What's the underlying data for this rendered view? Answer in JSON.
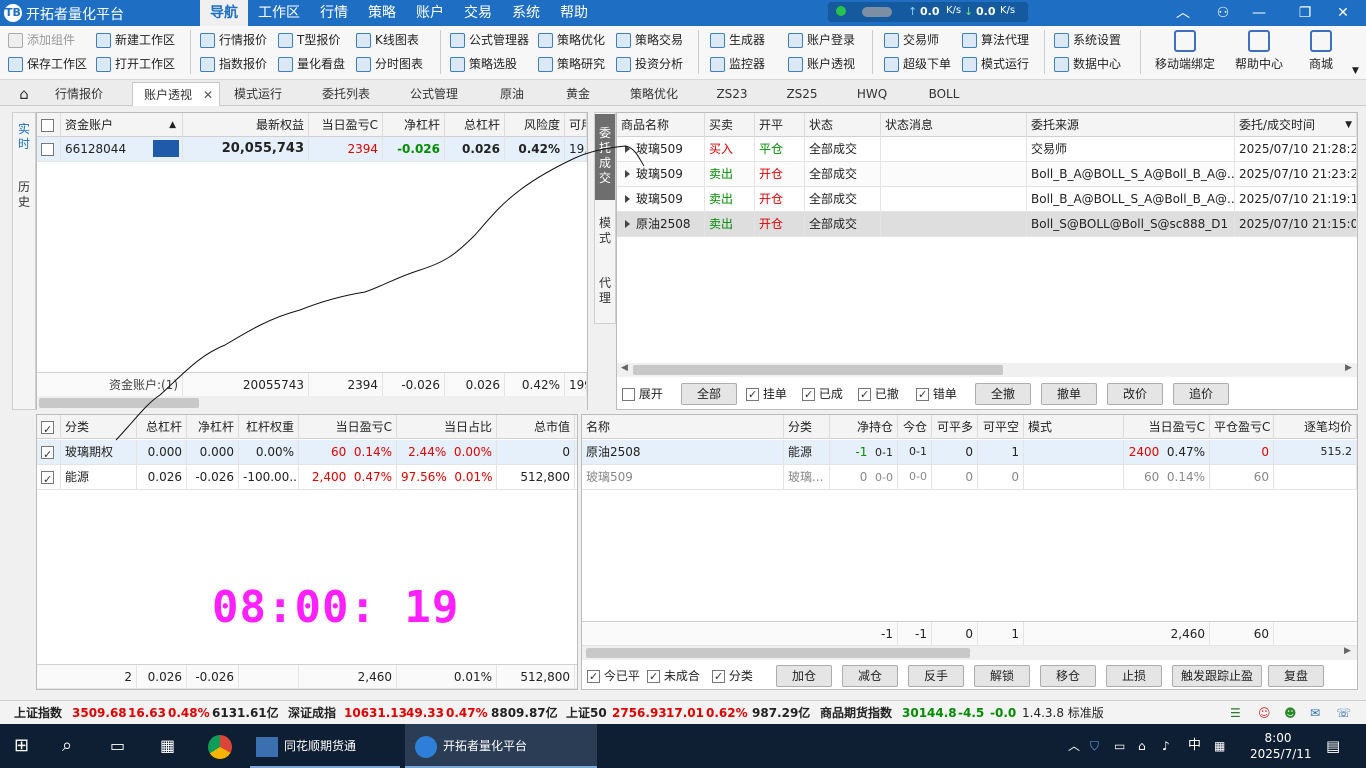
{
  "title_bar": {
    "app_title": "开拓者量化平台",
    "logo_text": "TB",
    "menu": [
      "导航",
      "工作区",
      "行情",
      "策略",
      "账户",
      "交易",
      "系统",
      "帮助"
    ],
    "net_up": "0.0",
    "net_down": "0.0",
    "net_unit": "K/s"
  },
  "toolbar": {
    "g1": [
      "添加组件",
      "新建工作区",
      "保存工作区",
      "打开工作区"
    ],
    "g2": [
      "行情报价",
      "T型报价",
      "K线图表",
      "指数报价",
      "量化看盘",
      "分时图表"
    ],
    "g3": [
      "公式管理器",
      "策略优化",
      "策略交易",
      "策略选股",
      "策略研究",
      "投资分析"
    ],
    "g4": [
      "生成器",
      "账户登录",
      "监控器",
      "账户透视"
    ],
    "g5": [
      "交易师",
      "算法代理",
      "超级下单",
      "模式运行"
    ],
    "g6": [
      "系统设置",
      "数据中心"
    ],
    "big": [
      "移动端绑定",
      "帮助中心",
      "商城"
    ]
  },
  "tabs": [
    "行情报价",
    "账户透视",
    "模式运行",
    "委托列表",
    "公式管理",
    "原油",
    "黄金",
    "策略优化",
    "ZS23",
    "ZS25",
    "HWQ",
    "BOLL"
  ],
  "left_vtabs": {
    "realtime": "实时",
    "history": "历史"
  },
  "account": {
    "headers": [
      "资金账户",
      "最新权益",
      "当日盈亏C",
      "净杠杆",
      "总杠杆",
      "风险度",
      "可用资"
    ],
    "row": {
      "id": "66128044",
      "equity": "20,055,743",
      "pnl": "2394",
      "net_lev": "-0.026",
      "tot_lev": "0.026",
      "risk": "0.42%",
      "avail": "19,970,7"
    },
    "footer": {
      "label": "资金账户:(1)",
      "equity": "20055743",
      "pnl": "2394",
      "net_lev": "-0.026",
      "tot_lev": "0.026",
      "risk": "0.42%",
      "avail": "199707..."
    }
  },
  "category": {
    "headers": [
      "分类",
      "总杠杆",
      "净杠杆",
      "杠杆权重",
      "当日盈亏C",
      "当日占比",
      "总市值"
    ],
    "rows": [
      {
        "name": "玻璃期权",
        "tot": "0.000",
        "net": "0.000",
        "weight": "0.00%",
        "pnl": "60",
        "pnl_pct": "0.14%",
        "share": "2.44%",
        "share2": "0.00%",
        "value": "0"
      },
      {
        "name": "能源",
        "tot": "0.026",
        "net": "-0.026",
        "weight": "-100.00...",
        "pnl": "2,400",
        "pnl_pct": "0.47%",
        "share": "97.56%",
        "share2": "0.01%",
        "value": "512,800"
      }
    ],
    "footer": {
      "count": "2",
      "tot": "0.026",
      "net": "-0.026",
      "pnl": "2,460",
      "share": "0.01%",
      "value": "512,800"
    }
  },
  "clock": "08:00: 19",
  "right_vtabs": {
    "orders": "委托成交",
    "mode": "模式",
    "agent": "代理"
  },
  "orders": {
    "headers": [
      "商品名称",
      "买卖",
      "开平",
      "状态",
      "状态消息",
      "委托来源",
      "委托/成交时间"
    ],
    "rows": [
      {
        "name": "玻璃509",
        "side": "买入",
        "oc": "平仓",
        "status": "全部成交",
        "msg": "",
        "src": "交易师",
        "time": "2025/07/10 21:28:26"
      },
      {
        "name": "玻璃509",
        "side": "卖出",
        "oc": "开仓",
        "status": "全部成交",
        "msg": "",
        "src": "Boll_B_A@BOLL_S_A@Boll_B_A@...",
        "time": "2025/07/10 21:23:20"
      },
      {
        "name": "玻璃509",
        "side": "卖出",
        "oc": "开仓",
        "status": "全部成交",
        "msg": "",
        "src": "Boll_B_A@BOLL_S_A@Boll_B_A@...",
        "time": "2025/07/10 21:19:18"
      },
      {
        "name": "原油2508",
        "side": "卖出",
        "oc": "开仓",
        "status": "全部成交",
        "msg": "",
        "src": "Boll_S@BOLL@Boll_S@sc888_D1",
        "time": "2025/07/10 21:15:00"
      }
    ],
    "controls": {
      "expand": "展开",
      "all": "全部",
      "pending": "挂单",
      "filled": "已成",
      "cancelled": "已撤",
      "error": "错单",
      "cancel_all": "全撤",
      "cancel": "撤单",
      "modify": "改价",
      "chase": "追价"
    }
  },
  "positions": {
    "headers": [
      "名称",
      "分类",
      "净持仓",
      "今仓",
      "可平多",
      "可平空",
      "模式",
      "当日盈亏C",
      "平仓盈亏C",
      "逐笔均价"
    ],
    "rows": [
      {
        "name": "原油2508",
        "cat": "能源",
        "net": "-1",
        "net2": "0-1",
        "today": "0-1",
        "long": "0",
        "short": "1",
        "mode": "",
        "pnl": "2400",
        "pnl_pct": "0.47%",
        "close_pnl": "0",
        "avg": "515.2"
      },
      {
        "name": "玻璃509",
        "cat": "玻璃...",
        "net": "0",
        "net2": "0-0",
        "today": "0-0",
        "long": "0",
        "short": "0",
        "mode": "",
        "pnl": "60",
        "pnl_pct": "0.14%",
        "close_pnl": "60",
        "avg": ""
      }
    ],
    "footer": {
      "net": "-1",
      "today": "-1",
      "long": "0",
      "short": "1",
      "pnl": "2,460",
      "close_pnl": "60"
    },
    "controls": {
      "today_closed": "今已平",
      "not_closed": "未成合",
      "category": "分类",
      "add": "加仓",
      "reduce": "减仓",
      "reverse": "反手",
      "unlock": "解锁",
      "move": "移仓",
      "stop": "止损",
      "trail": "触发跟踪止盈",
      "restore": "复盘"
    }
  },
  "status_bar": {
    "idx1": {
      "name": "上证指数",
      "price": "3509.68",
      "chg": "16.63",
      "pct": "0.48%",
      "amt": "6131.61亿"
    },
    "idx2": {
      "name": "深证成指",
      "price": "10631.13",
      "chg": "49.33",
      "pct": "0.47%",
      "amt": "8809.87亿"
    },
    "idx3": {
      "name": "上证50",
      "price": "2756.93",
      "chg": "17.01",
      "pct": "0.62%",
      "amt": "987.29亿"
    },
    "idx4": {
      "name": "商品期货指数",
      "price": "30144.8",
      "chg": "-4.5",
      "pct": "-0.0"
    },
    "version": "1.4.3.8 标准版"
  },
  "taskbar": {
    "app1": "同花顺期货通",
    "app2": "开拓者量化平台",
    "ime": "中",
    "time": "8:00",
    "date": "2025/7/11"
  },
  "colors": {
    "accent": "#1e6fc3",
    "up": "#e00000",
    "down": "#008c00",
    "clock": "#ff20ff"
  }
}
